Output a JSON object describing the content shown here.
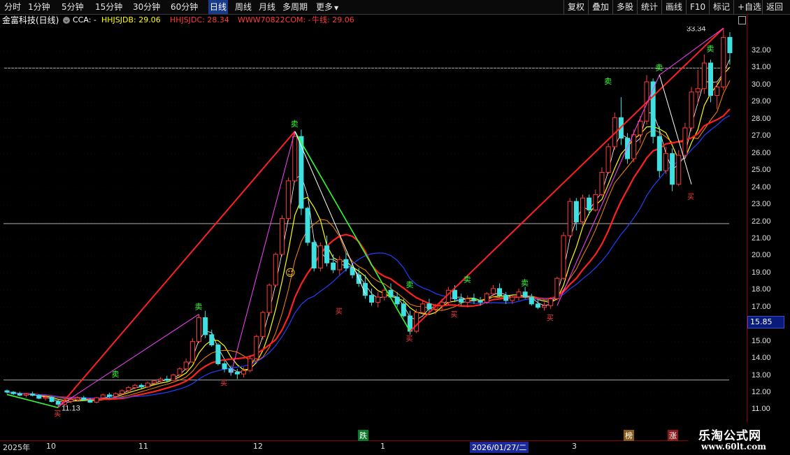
{
  "toolbar": {
    "periods": [
      "分时",
      "1分钟",
      "5分钟",
      "15分钟",
      "30分钟",
      "60分钟",
      "日线",
      "周线",
      "月线",
      "多周期",
      "更多"
    ],
    "active": "日线",
    "buttons": [
      "复权",
      "叠加",
      "多股",
      "统计",
      "画线",
      "F10",
      "标记",
      "+自选",
      "返回"
    ]
  },
  "infobar": {
    "stock": "金富科技(日线)",
    "cca_label": "CCA: -",
    "jdb_label": "HHJSJDB: 29.06",
    "jdc_label": "HHJSJDC: 28.34",
    "www_label": "WWW70822COM: -",
    "niu_label": "牛线: 29.06"
  },
  "price_axis": {
    "labels": [
      "32.00",
      "31.00",
      "30.00",
      "29.00",
      "28.00",
      "27.00",
      "26.00",
      "25.00",
      "24.00",
      "23.00",
      "22.00",
      "21.00",
      "20.00",
      "19.00",
      "18.00",
      "17.00",
      "15.85",
      "15.00",
      "14.00",
      "13.00",
      "12.00",
      "11.00"
    ],
    "current": "15.85"
  },
  "annotations": {
    "high": "33.34",
    "low": "11.13",
    "sell_marks": [
      "卖",
      "卖",
      "卖",
      "卖",
      "卖",
      "卖",
      "卖",
      "卖",
      "卖"
    ],
    "buy_marks": [
      "买",
      "买",
      "买",
      "买",
      "买",
      "买",
      "买"
    ],
    "emoji": "☺"
  },
  "date_axis": {
    "labels": [
      "2025年",
      "10",
      "11",
      "12",
      "1",
      "2026/01/27/二",
      "3"
    ],
    "events": [
      "跌",
      "榜",
      "涨"
    ]
  },
  "watermark": {
    "title": "乐淘公式网",
    "url": "www.60lt.com"
  },
  "colors": {
    "up": "#ff3a3a",
    "down": "#40e0e0",
    "ma1": "#ffffff",
    "ma2": "#ffff00",
    "ma3": "#ff00ff",
    "ma4": "#ff2020",
    "ma5": "#2040ff",
    "trend_red": "#ff2020",
    "trend_green": "#30ff30",
    "trend_magenta": "#ff40ff"
  },
  "chart_data": {
    "type": "candlestick",
    "ylim": [
      10.6,
      33.8
    ],
    "highlighted_date": "2026/01/27/二",
    "ohlc": [
      [
        12.12,
        12.19,
        11.95,
        12.04
      ],
      [
        12.04,
        12.1,
        11.88,
        11.95
      ],
      [
        11.95,
        12.06,
        11.8,
        11.86
      ],
      [
        11.86,
        11.99,
        11.73,
        11.93
      ],
      [
        11.93,
        12.07,
        11.79,
        11.85
      ],
      [
        11.85,
        11.92,
        11.62,
        11.68
      ],
      [
        11.68,
        11.82,
        11.55,
        11.74
      ],
      [
        11.74,
        11.8,
        11.44,
        11.49
      ],
      [
        11.49,
        11.63,
        11.13,
        11.33
      ],
      [
        11.33,
        11.55,
        11.22,
        11.49
      ],
      [
        11.49,
        11.73,
        11.39,
        11.6
      ],
      [
        11.6,
        11.79,
        11.49,
        11.7
      ],
      [
        11.7,
        11.82,
        11.54,
        11.58
      ],
      [
        11.58,
        11.69,
        11.4,
        11.45
      ],
      [
        11.45,
        11.76,
        11.38,
        11.71
      ],
      [
        11.71,
        11.95,
        11.62,
        11.88
      ],
      [
        11.88,
        12.01,
        11.71,
        11.79
      ],
      [
        11.79,
        12.02,
        11.7,
        11.95
      ],
      [
        11.95,
        12.2,
        11.86,
        12.12
      ],
      [
        12.12,
        12.4,
        12.01,
        12.3
      ],
      [
        12.3,
        12.52,
        12.21,
        12.44
      ],
      [
        12.44,
        12.55,
        12.25,
        12.34
      ],
      [
        12.34,
        12.65,
        12.29,
        12.57
      ],
      [
        12.57,
        12.77,
        12.48,
        12.7
      ],
      [
        12.7,
        12.91,
        12.62,
        12.8
      ],
      [
        12.8,
        13.0,
        12.65,
        12.73
      ],
      [
        12.73,
        13.12,
        12.7,
        13.05
      ],
      [
        13.05,
        13.5,
        13.0,
        13.4
      ],
      [
        13.4,
        14.0,
        13.3,
        13.8
      ],
      [
        13.8,
        15.2,
        13.75,
        15.0
      ],
      [
        15.0,
        16.6,
        14.9,
        16.4
      ],
      [
        16.4,
        16.8,
        15.2,
        15.4
      ],
      [
        15.4,
        15.7,
        14.7,
        14.8
      ],
      [
        14.8,
        14.9,
        13.6,
        13.7
      ],
      [
        13.7,
        13.9,
        13.2,
        13.4
      ],
      [
        13.4,
        13.6,
        13.0,
        13.2
      ],
      [
        13.2,
        13.4,
        12.8,
        13.1
      ],
      [
        13.1,
        13.5,
        12.9,
        13.3
      ],
      [
        13.3,
        14.2,
        13.2,
        14.0
      ],
      [
        14.0,
        15.4,
        13.9,
        15.3
      ],
      [
        15.3,
        16.8,
        15.1,
        16.7
      ],
      [
        16.7,
        18.4,
        16.5,
        18.3
      ],
      [
        18.3,
        20.2,
        18.2,
        20.1
      ],
      [
        20.1,
        22.4,
        20.0,
        22.2
      ],
      [
        22.2,
        24.6,
        22.0,
        24.4
      ],
      [
        24.4,
        27.3,
        24.3,
        27.0
      ],
      [
        27.0,
        27.4,
        22.4,
        22.8
      ],
      [
        22.8,
        22.9,
        20.6,
        20.8
      ],
      [
        20.8,
        21.0,
        19.1,
        19.3
      ],
      [
        19.3,
        20.8,
        19.1,
        20.6
      ],
      [
        20.6,
        21.2,
        19.4,
        19.6
      ],
      [
        19.6,
        20.1,
        19.0,
        19.2
      ],
      [
        19.2,
        20.0,
        18.9,
        19.8
      ],
      [
        19.8,
        20.2,
        19.1,
        19.3
      ],
      [
        19.3,
        19.6,
        18.7,
        18.9
      ],
      [
        18.9,
        19.3,
        18.2,
        18.4
      ],
      [
        18.4,
        18.9,
        17.5,
        17.7
      ],
      [
        17.7,
        18.1,
        17.1,
        17.3
      ],
      [
        17.3,
        17.9,
        17.0,
        17.6
      ],
      [
        17.6,
        18.2,
        17.4,
        18.0
      ],
      [
        18.0,
        18.4,
        17.5,
        17.6
      ],
      [
        17.6,
        17.9,
        17.0,
        17.2
      ],
      [
        17.2,
        17.5,
        16.4,
        16.5
      ],
      [
        16.5,
        16.8,
        15.4,
        15.6
      ],
      [
        15.6,
        16.9,
        15.5,
        16.7
      ],
      [
        16.7,
        17.4,
        16.5,
        17.2
      ],
      [
        17.2,
        17.5,
        16.7,
        16.9
      ],
      [
        16.9,
        17.2,
        16.6,
        17.1
      ],
      [
        17.1,
        17.5,
        16.8,
        17.3
      ],
      [
        17.3,
        18.2,
        17.1,
        18.0
      ],
      [
        18.0,
        18.3,
        17.3,
        17.5
      ],
      [
        17.5,
        17.8,
        17.1,
        17.3
      ],
      [
        17.3,
        17.7,
        17.0,
        17.5
      ],
      [
        17.5,
        17.8,
        17.2,
        17.4
      ],
      [
        17.4,
        17.6,
        17.1,
        17.3
      ],
      [
        17.3,
        17.9,
        17.2,
        17.8
      ],
      [
        17.8,
        18.3,
        17.6,
        18.1
      ],
      [
        18.1,
        18.4,
        17.6,
        17.7
      ],
      [
        17.7,
        17.9,
        17.2,
        17.4
      ],
      [
        17.4,
        17.7,
        17.2,
        17.6
      ],
      [
        17.6,
        18.1,
        17.4,
        17.9
      ],
      [
        17.9,
        18.2,
        17.5,
        17.6
      ],
      [
        17.6,
        17.8,
        17.1,
        17.2
      ],
      [
        17.2,
        17.5,
        16.9,
        17.0
      ],
      [
        17.0,
        17.3,
        16.8,
        17.1
      ],
      [
        17.1,
        17.6,
        16.9,
        17.5
      ],
      [
        17.5,
        18.8,
        17.4,
        18.7
      ],
      [
        18.7,
        21.4,
        18.6,
        21.2
      ],
      [
        21.2,
        23.4,
        21.0,
        23.2
      ],
      [
        23.2,
        23.4,
        21.5,
        22.0
      ],
      [
        22.0,
        23.6,
        21.8,
        23.4
      ],
      [
        23.4,
        23.6,
        22.4,
        22.7
      ],
      [
        22.7,
        23.9,
        22.6,
        23.6
      ],
      [
        23.6,
        25.2,
        23.5,
        24.9
      ],
      [
        24.9,
        26.6,
        24.8,
        26.4
      ],
      [
        26.4,
        28.4,
        26.2,
        28.1
      ],
      [
        28.1,
        29.3,
        26.5,
        26.9
      ],
      [
        26.9,
        27.2,
        25.4,
        25.7
      ],
      [
        25.7,
        27.4,
        25.5,
        27.1
      ],
      [
        27.1,
        28.2,
        26.6,
        27.9
      ],
      [
        27.9,
        30.6,
        27.7,
        30.2
      ],
      [
        30.2,
        30.4,
        26.6,
        27.0
      ],
      [
        27.0,
        27.6,
        24.6,
        25.0
      ],
      [
        25.0,
        26.4,
        24.8,
        26.0
      ],
      [
        26.0,
        26.3,
        23.8,
        24.2
      ],
      [
        24.2,
        26.2,
        24.1,
        25.9
      ],
      [
        25.9,
        27.8,
        25.7,
        27.5
      ],
      [
        27.5,
        29.9,
        27.3,
        29.6
      ],
      [
        29.6,
        30.9,
        28.9,
        29.8
      ],
      [
        29.8,
        31.8,
        29.5,
        31.3
      ],
      [
        31.3,
        31.5,
        29.0,
        29.4
      ],
      [
        29.4,
        30.2,
        28.6,
        29.9
      ],
      [
        29.9,
        33.34,
        29.7,
        32.8
      ],
      [
        32.8,
        33.1,
        31.2,
        31.9
      ]
    ]
  }
}
